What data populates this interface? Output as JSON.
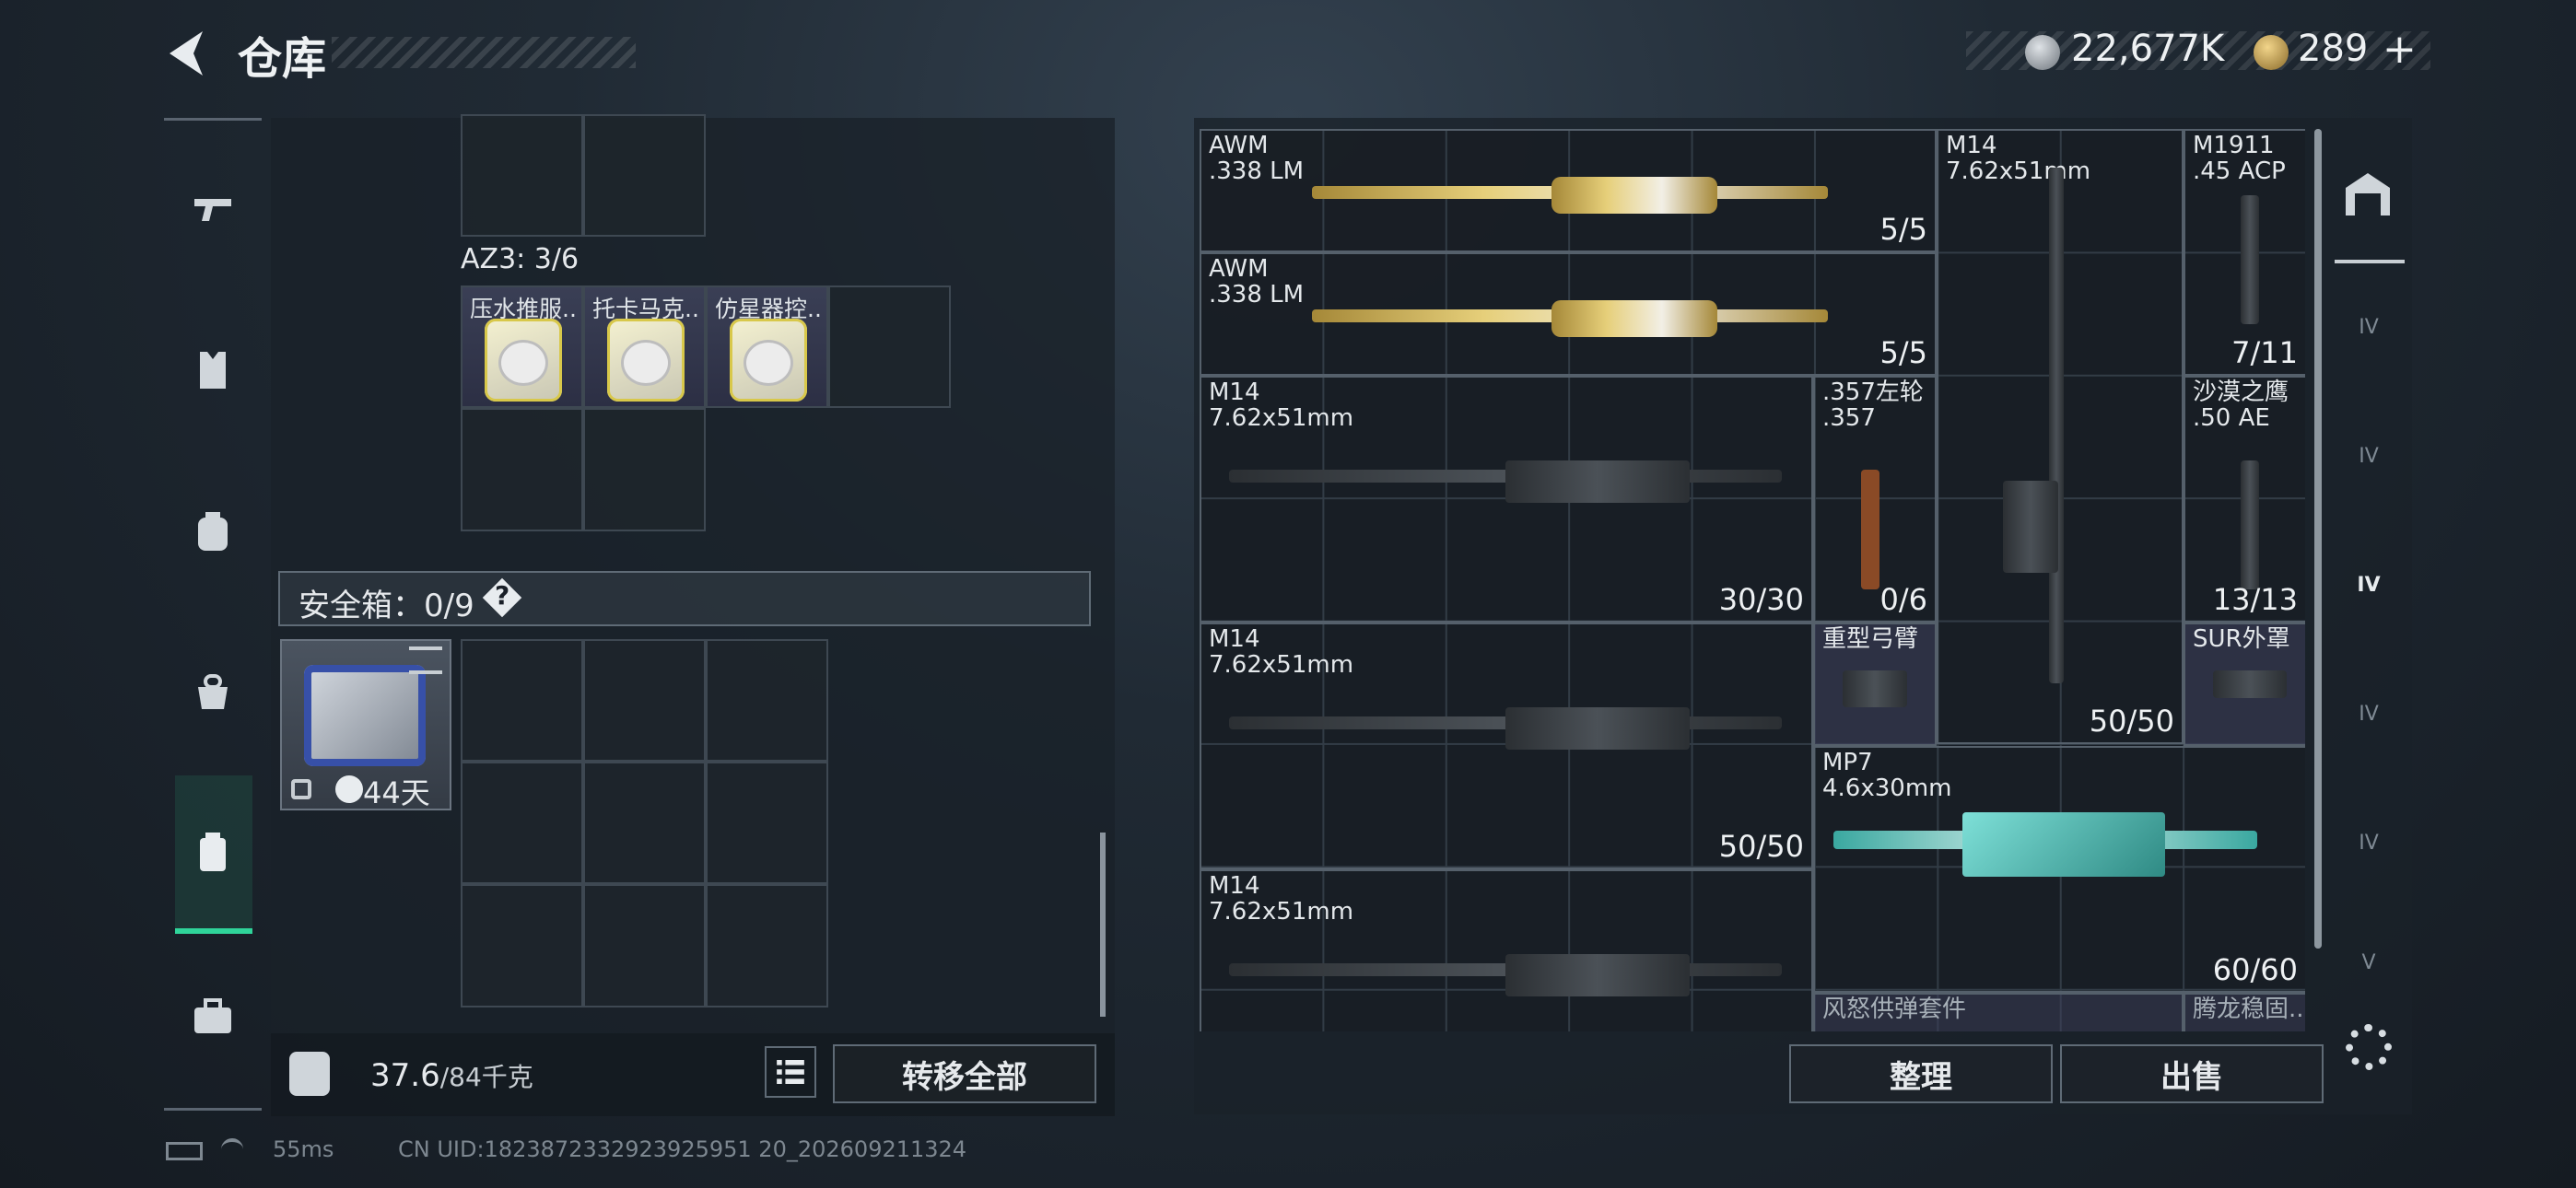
{
  "header": {
    "title": "仓库",
    "currency_silver": "22,677K",
    "currency_gold": "289",
    "add_label": "+"
  },
  "sidebar": {
    "items": [
      "pistol-icon",
      "vest-icon",
      "backpack-icon",
      "bag-icon",
      "container-icon",
      "toolbox-icon"
    ],
    "active": 4
  },
  "storage": {
    "az3_label": "AZ3: 3/6",
    "az3_items": [
      "压水推服...",
      "托卡马克...",
      "仿星器控..."
    ],
    "safe_label": "安全箱：0/9",
    "safe_help": "?",
    "safe_days": "44天",
    "weight_current": "37.6",
    "weight_total": "/84千克",
    "transfer_label": "转移全部"
  },
  "weapons": [
    {
      "name": "AWM\n.338 LM",
      "count": "5/5"
    },
    {
      "name": "AWM\n.338 LM",
      "count": "5/5"
    },
    {
      "name": "M14\n7.62x51mm",
      "count": ""
    },
    {
      "name": "M1911\n.45 ACP",
      "count": "7/11"
    },
    {
      "name": "M14\n7.62x51mm",
      "count": "30/30"
    },
    {
      "name": ".357左轮\n.357",
      "count": "0/6"
    },
    {
      "name": "沙漠之鹰\n.50 AE",
      "count": "13/13"
    },
    {
      "name": "M14\n7.62x51mm",
      "count": "50/50"
    },
    {
      "name": "重型弓臂",
      "count": ""
    },
    {
      "name": "SUR外罩",
      "count": ""
    },
    {
      "name": "MP7\n4.6x30mm",
      "count": "60/60"
    },
    {
      "name": "M14\n7.62x51mm",
      "count": ""
    },
    {
      "name": "风怒供弹套件",
      "count": ""
    },
    {
      "name": "腾龙稳固...",
      "count": ""
    }
  ],
  "m14_tall_count": "50/50",
  "right_actions": {
    "tidy": "整理",
    "sell": "出售"
  },
  "right_tabs": [
    "IV",
    "IV",
    "IV",
    "IV",
    "IV",
    "V"
  ],
  "footer": {
    "ping": "55ms",
    "uid": "CN UID:1823872332923925951 20_202609211324"
  }
}
